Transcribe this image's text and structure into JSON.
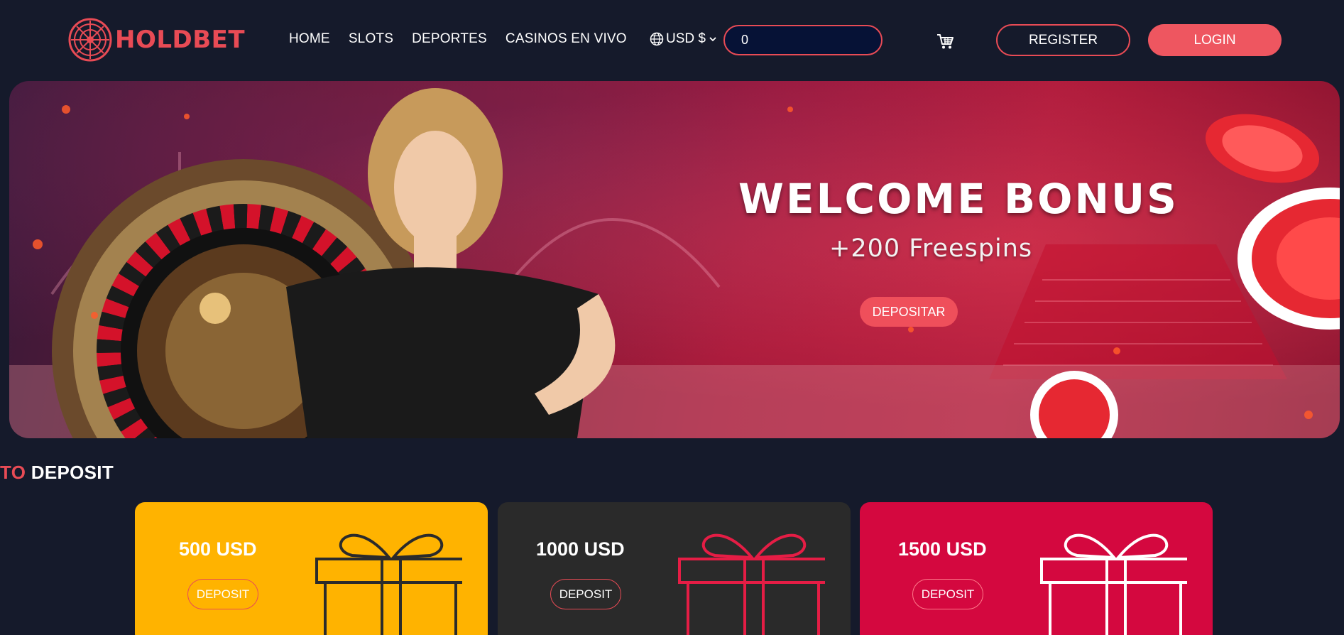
{
  "brand": {
    "name": "HOLDBET",
    "accent_color": "#e84b55",
    "background_color": "#151a2b"
  },
  "nav": {
    "items": [
      {
        "label": "HOME"
      },
      {
        "label": "SLOTS"
      },
      {
        "label": "DEPORTES"
      },
      {
        "label": "CASINOS EN VIVO"
      }
    ]
  },
  "currency": {
    "selected": "USD $",
    "icon": "globe-icon"
  },
  "balance": {
    "value": "0"
  },
  "cart": {
    "icon": "cart-icon"
  },
  "auth": {
    "register_label": "REGISTER",
    "login_label": "LOGIN"
  },
  "hero": {
    "title": "WELCOME BONUS",
    "subtitle": "+200 Freespins",
    "cta_label": "DEPOSITAR"
  },
  "deposit_section": {
    "title_accent": "TO",
    "title_rest": "DEPOSIT",
    "cards": [
      {
        "amount": "500 USD",
        "button_label": "DEPOSIT",
        "bg_color": "#ffb300",
        "gift_color": "#2b2b2b"
      },
      {
        "amount": "1000 USD",
        "button_label": "DEPOSIT",
        "bg_color": "#2a2a2a",
        "gift_color": "#e51d45"
      },
      {
        "amount": "1500 USD",
        "button_label": "DEPOSIT",
        "bg_color": "#d4083f",
        "gift_color": "#ffffff"
      }
    ]
  }
}
